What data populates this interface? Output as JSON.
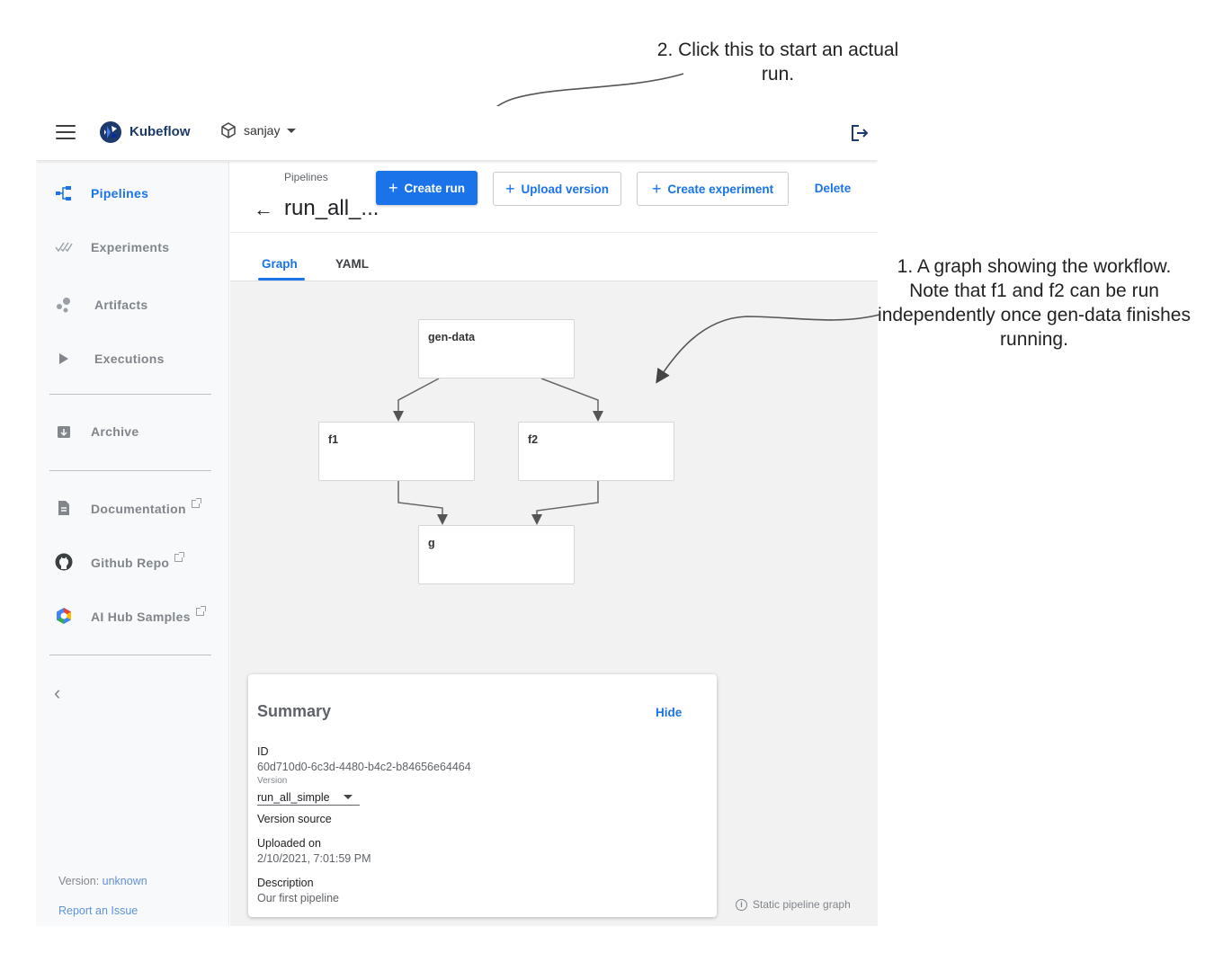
{
  "annotations": {
    "run_note": "2. Click this to start an actual run.",
    "graph_note": "1. A graph showing the workflow. Note that f1 and f2 can be run independently once gen-data finishes running."
  },
  "topbar": {
    "brand": "Kubeflow",
    "namespace": "sanjay"
  },
  "sidebar": {
    "items": [
      {
        "label": "Pipelines",
        "icon": "pipelines-icon",
        "active": true
      },
      {
        "label": "Experiments",
        "icon": "experiments-icon"
      },
      {
        "label": "Artifacts",
        "icon": "artifacts-icon"
      },
      {
        "label": "Executions",
        "icon": "play-icon"
      },
      {
        "label": "Archive",
        "icon": "archive-icon"
      },
      {
        "label": "Documentation",
        "icon": "document-icon",
        "external": true
      },
      {
        "label": "Github Repo",
        "icon": "github-icon",
        "external": true
      },
      {
        "label": "AI Hub Samples",
        "icon": "ai-hub-icon",
        "external": true
      }
    ],
    "version_label": "Version:",
    "version_value": "unknown",
    "report_issue": "Report an Issue"
  },
  "header": {
    "breadcrumb": "Pipelines",
    "title": "run_all_...",
    "buttons": {
      "create_run": "Create run",
      "upload_version": "Upload version",
      "create_experiment": "Create experiment",
      "delete": "Delete"
    }
  },
  "tabs": [
    "Graph",
    "YAML"
  ],
  "graph": {
    "nodes": [
      "gen-data",
      "f1",
      "f2",
      "g"
    ],
    "note": "Static pipeline graph"
  },
  "summary": {
    "title": "Summary",
    "hide": "Hide",
    "id_label": "ID",
    "id_value": "60d710d0-6c3d-4480-b4c2-b84656e64464",
    "version_label": "Version",
    "version_value": "run_all_simple",
    "version_source_label": "Version source",
    "uploaded_label": "Uploaded on",
    "uploaded_value": "2/10/2021, 7:01:59 PM",
    "description_label": "Description",
    "description_value": "Our first pipeline"
  },
  "colors": {
    "accent": "#1a73e8",
    "brand": "#1c3a6b",
    "graph_bg": "#f2f2f2"
  }
}
